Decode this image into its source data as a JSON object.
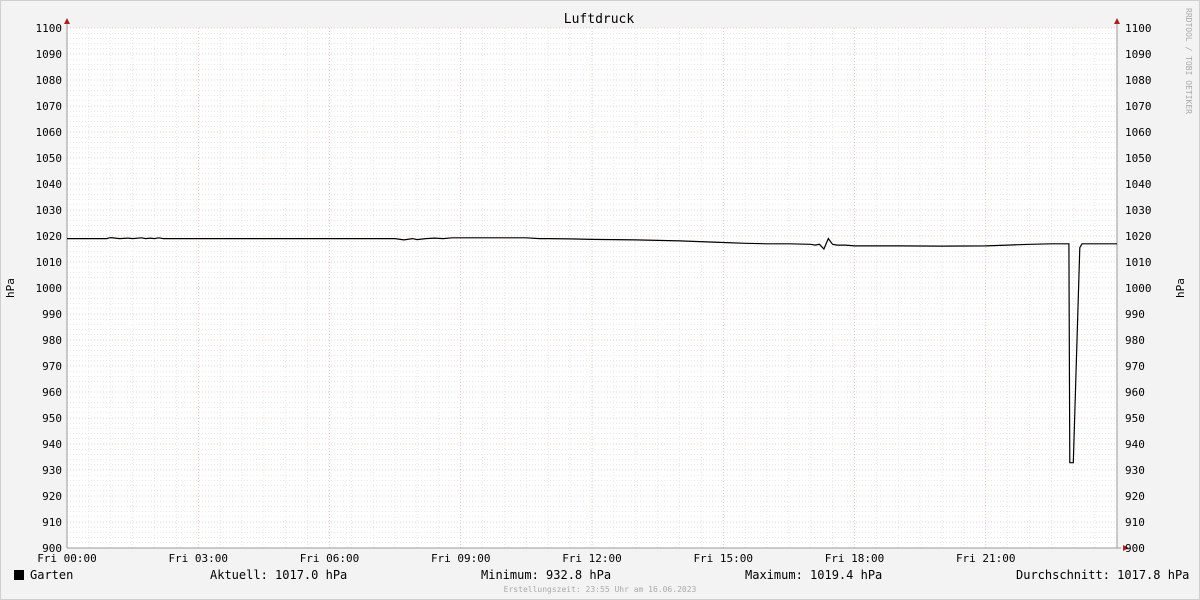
{
  "chart_data": {
    "type": "line",
    "title": "Luftdruck",
    "ylabel": "hPa",
    "ylabel_right": "hPa",
    "ylim": [
      900,
      1100
    ],
    "y_ticks": [
      900,
      910,
      920,
      930,
      940,
      950,
      960,
      970,
      980,
      990,
      1000,
      1010,
      1020,
      1030,
      1040,
      1050,
      1060,
      1070,
      1080,
      1090,
      1100
    ],
    "x_range_hours": [
      0,
      24
    ],
    "x_ticks": [
      {
        "hour": 0,
        "label": "Fri 00:00"
      },
      {
        "hour": 3,
        "label": "Fri 03:00"
      },
      {
        "hour": 6,
        "label": "Fri 06:00"
      },
      {
        "hour": 9,
        "label": "Fri 09:00"
      },
      {
        "hour": 12,
        "label": "Fri 12:00"
      },
      {
        "hour": 15,
        "label": "Fri 15:00"
      },
      {
        "hour": 18,
        "label": "Fri 18:00"
      },
      {
        "hour": 21,
        "label": "Fri 21:00"
      }
    ],
    "grid": true,
    "series": [
      {
        "name": "Garten",
        "color": "#000000",
        "x_hours": [
          0.0,
          0.9,
          1.0,
          1.2,
          1.4,
          1.5,
          1.7,
          1.8,
          1.9,
          2.0,
          2.1,
          2.2,
          2.4,
          3.0,
          4.0,
          5.0,
          6.0,
          7.0,
          7.5,
          7.7,
          7.9,
          8.0,
          8.2,
          8.4,
          8.6,
          8.8,
          9.0,
          10.0,
          10.5,
          10.8,
          11.0,
          11.5,
          12.0,
          13.0,
          14.0,
          15.0,
          15.5,
          16.0,
          16.5,
          17.0,
          17.1,
          17.2,
          17.3,
          17.4,
          17.5,
          17.6,
          17.8,
          18.0,
          18.5,
          19.0,
          20.0,
          21.0,
          21.5,
          22.0,
          22.5,
          22.9,
          22.92,
          23.0,
          23.15,
          23.2,
          24.0
        ],
        "values": [
          1019.0,
          1019.0,
          1019.4,
          1019.0,
          1019.2,
          1019.0,
          1019.3,
          1019.0,
          1019.2,
          1019.0,
          1019.3,
          1019.0,
          1019.0,
          1019.0,
          1019.0,
          1019.0,
          1019.0,
          1019.0,
          1019.0,
          1018.5,
          1019.0,
          1018.6,
          1019.0,
          1019.2,
          1019.0,
          1019.3,
          1019.3,
          1019.3,
          1019.3,
          1019.0,
          1019.0,
          1018.9,
          1018.7,
          1018.5,
          1018.1,
          1017.5,
          1017.2,
          1017.0,
          1017.0,
          1016.8,
          1016.5,
          1016.8,
          1015.0,
          1019.0,
          1016.8,
          1016.5,
          1016.5,
          1016.2,
          1016.2,
          1016.2,
          1016.1,
          1016.2,
          1016.5,
          1016.8,
          1017.0,
          1017.0,
          932.8,
          932.8,
          1015.5,
          1017.0,
          1017.0
        ]
      }
    ]
  },
  "legend": {
    "series_label": "Garten",
    "current": "Aktuell: 1017.0 hPa",
    "minimum": "Minimum: 932.8 hPa",
    "maximum": "Maximum: 1019.4 hPa",
    "average": "Durchschnitt: 1017.8 hPa"
  },
  "footer": "Erstellungszeit: 23:55 Uhr am 16.06.2023",
  "watermark": "RRDTOOL / TOBI OETIKER",
  "colors": {
    "background": "#f3f3f3",
    "plot_background": "#ffffff",
    "grid_minor": "#dcdcdc",
    "grid_major": "#e8a0a0",
    "axis": "#999999",
    "arrow": "#aa2222",
    "line": "#000000"
  }
}
